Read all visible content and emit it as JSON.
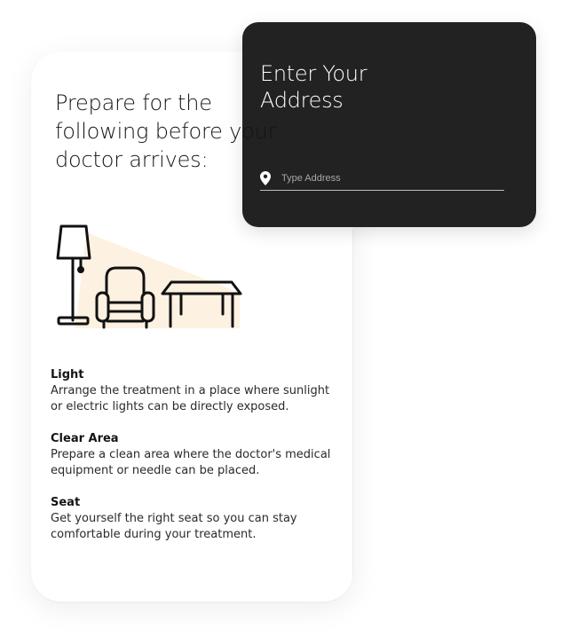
{
  "instructions": {
    "headline": "Prepare for the\nfollowing before your\ndoctor arrives:",
    "illustration": {
      "name": "lamp-armchair-table-illustration",
      "light_cone_color": "#fdf1e1"
    },
    "tips": [
      {
        "title": "Light",
        "text": "Arrange the treatment in a place where sunlight or electric lights can be directly exposed."
      },
      {
        "title": "Clear Area",
        "text": "Prepare a clean area where the doctor's medical equipment or needle can be placed."
      },
      {
        "title": "Seat",
        "text": "Get yourself the right seat so you can stay comfortable during your treatment."
      }
    ]
  },
  "address_panel": {
    "title": "Enter Your\nAddress",
    "input": {
      "placeholder": "Type Address",
      "value": "",
      "icon": "location-pin-icon"
    },
    "background_color": "#222222"
  }
}
